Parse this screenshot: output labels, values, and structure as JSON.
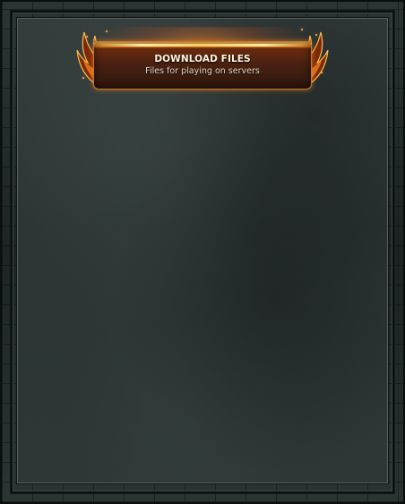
{
  "banner": {
    "title": "DOWNLOAD FILES",
    "subtitle": "Files for playing on servers",
    "icons": [
      "flame-wing-icon"
    ]
  },
  "colors": {
    "frame": "#1c2523",
    "panel": "#2e3736",
    "banner_glow": "#f48a1f",
    "banner_plate": "#4a2212",
    "title_text": "#fff3df",
    "subtitle_text": "#e6d6c2"
  }
}
